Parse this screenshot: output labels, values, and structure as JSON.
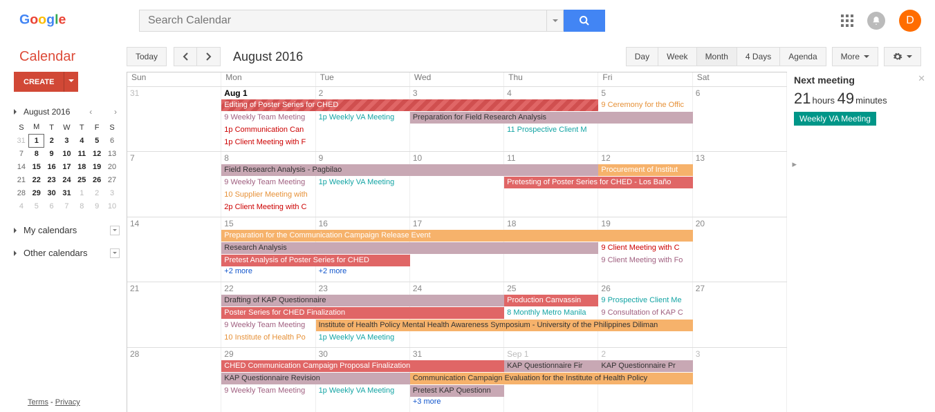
{
  "header": {
    "search_placeholder": "Search Calendar",
    "avatar_letter": "D"
  },
  "toolbar": {
    "brand": "Calendar",
    "today": "Today",
    "date_title": "August 2016",
    "views": [
      "Day",
      "Week",
      "Month",
      "4 Days",
      "Agenda"
    ],
    "active_view": 2,
    "more": "More"
  },
  "sidebar": {
    "create": "CREATE",
    "minical_title": "August 2016",
    "dow": [
      "S",
      "M",
      "T",
      "W",
      "T",
      "F",
      "S"
    ],
    "rows": [
      [
        {
          "n": 31,
          "g": 1
        },
        {
          "n": 1,
          "b": 1,
          "t": 1
        },
        {
          "n": 2,
          "b": 1
        },
        {
          "n": 3,
          "b": 1
        },
        {
          "n": 4,
          "b": 1
        },
        {
          "n": 5,
          "b": 1
        },
        {
          "n": 6
        }
      ],
      [
        {
          "n": 7
        },
        {
          "n": 8,
          "b": 1
        },
        {
          "n": 9,
          "b": 1
        },
        {
          "n": 10,
          "b": 1
        },
        {
          "n": 11,
          "b": 1
        },
        {
          "n": 12,
          "b": 1
        },
        {
          "n": 13
        }
      ],
      [
        {
          "n": 14
        },
        {
          "n": 15,
          "b": 1
        },
        {
          "n": 16,
          "b": 1
        },
        {
          "n": 17,
          "b": 1
        },
        {
          "n": 18,
          "b": 1
        },
        {
          "n": 19,
          "b": 1
        },
        {
          "n": 20
        }
      ],
      [
        {
          "n": 21
        },
        {
          "n": 22,
          "b": 1
        },
        {
          "n": 23,
          "b": 1
        },
        {
          "n": 24,
          "b": 1
        },
        {
          "n": 25,
          "b": 1
        },
        {
          "n": 26,
          "b": 1
        },
        {
          "n": 27
        }
      ],
      [
        {
          "n": 28
        },
        {
          "n": 29,
          "b": 1
        },
        {
          "n": 30,
          "b": 1
        },
        {
          "n": 31,
          "b": 1
        },
        {
          "n": 1,
          "g": 1
        },
        {
          "n": 2,
          "g": 1
        },
        {
          "n": 3,
          "g": 1
        }
      ],
      [
        {
          "n": 4,
          "g": 1
        },
        {
          "n": 5,
          "g": 1
        },
        {
          "n": 6,
          "g": 1
        },
        {
          "n": 7,
          "g": 1
        },
        {
          "n": 8,
          "g": 1
        },
        {
          "n": 9,
          "g": 1
        },
        {
          "n": 10,
          "g": 1
        }
      ]
    ],
    "my_calendars": "My calendars",
    "other_calendars": "Other calendars",
    "terms": "Terms",
    "privacy": "Privacy"
  },
  "calendar": {
    "day_headers": [
      "Sun",
      "Mon",
      "Tue",
      "Wed",
      "Thu",
      "Fri",
      "Sat"
    ],
    "weeks": [
      {
        "days": [
          {
            "num": "31",
            "other": 1
          },
          {
            "num": "Aug 1",
            "today": 1
          },
          {
            "num": "2"
          },
          {
            "num": "3"
          },
          {
            "num": "4"
          },
          {
            "num": "5"
          },
          {
            "num": "6"
          }
        ],
        "spans": [
          {
            "row": 0,
            "start": 1,
            "end": 5,
            "cls": "c-red-stripe",
            "text": "Editing of Poster Series for CHED"
          },
          {
            "row": 1,
            "start": 3,
            "end": 6,
            "cls": "c-mauve",
            "text": "Preparation for Field Research Analysis"
          }
        ],
        "cells": {
          "1": [
            {
              "cls": "t-mauve",
              "text": "9 Weekly Team Meeting",
              "row": 1
            },
            {
              "cls": "t-red",
              "text": "1p Communication Can",
              "row": 2
            },
            {
              "cls": "t-red",
              "text": "1p Client Meeting with F",
              "row": 3
            }
          ],
          "2": [
            {
              "cls": "t-teal",
              "text": "1p Weekly VA Meeting",
              "row": 1
            }
          ],
          "4": [
            {
              "cls": "t-teal",
              "text": "11 Prospective Client M",
              "row": 2
            }
          ],
          "5": [
            {
              "cls": "t-orange",
              "text": "9 Ceremony for the Offic",
              "row": 0
            }
          ]
        }
      },
      {
        "days": [
          {
            "num": "7"
          },
          {
            "num": "8"
          },
          {
            "num": "9"
          },
          {
            "num": "10"
          },
          {
            "num": "11"
          },
          {
            "num": "12"
          },
          {
            "num": "13"
          }
        ],
        "spans": [
          {
            "row": 0,
            "start": 1,
            "end": 5,
            "cls": "c-mauve",
            "text": "Field Research Analysis - Pagbilao"
          },
          {
            "row": 1,
            "start": 4,
            "end": 6,
            "cls": "c-red",
            "text": "Pretesting of Poster Series for CHED - Los Baño"
          }
        ],
        "cells": {
          "1": [
            {
              "cls": "t-mauve",
              "text": "9 Weekly Team Meeting",
              "row": 1
            },
            {
              "cls": "t-orange",
              "text": "10 Supplier Meeting with",
              "row": 2
            },
            {
              "cls": "t-red",
              "text": "2p Client Meeting with C",
              "row": 3
            }
          ],
          "2": [
            {
              "cls": "t-teal",
              "text": "1p Weekly VA Meeting",
              "row": 1
            }
          ],
          "5": [
            {
              "cls": "c-orange",
              "text": "Procurement of Institut",
              "row": 0,
              "block": 1
            }
          ]
        }
      },
      {
        "days": [
          {
            "num": "14"
          },
          {
            "num": "15"
          },
          {
            "num": "16"
          },
          {
            "num": "17"
          },
          {
            "num": "18"
          },
          {
            "num": "19"
          },
          {
            "num": "20"
          }
        ],
        "spans": [
          {
            "row": 0,
            "start": 1,
            "end": 6,
            "cls": "c-orange",
            "text": "Preparation for the Communication Campaign Release Event"
          },
          {
            "row": 1,
            "start": 1,
            "end": 5,
            "cls": "c-mauve",
            "text": "Research Analysis"
          },
          {
            "row": 2,
            "start": 1,
            "end": 3,
            "cls": "c-red",
            "text": "Pretest Analysis of Poster Series for CHED"
          }
        ],
        "cells": {
          "1": [
            {
              "cls": "more",
              "text": "+2 more",
              "row": 3,
              "more": 1
            }
          ],
          "2": [
            {
              "cls": "more",
              "text": "+2 more",
              "row": 3,
              "more": 1
            }
          ],
          "5": [
            {
              "cls": "t-red",
              "text": "9 Client Meeting with C",
              "row": 1
            },
            {
              "cls": "t-mauve",
              "text": "9 Client Meeting with Fo",
              "row": 2
            }
          ]
        }
      },
      {
        "days": [
          {
            "num": "21"
          },
          {
            "num": "22"
          },
          {
            "num": "23"
          },
          {
            "num": "24"
          },
          {
            "num": "25"
          },
          {
            "num": "26"
          },
          {
            "num": "27"
          }
        ],
        "spans": [
          {
            "row": 0,
            "start": 1,
            "end": 4,
            "cls": "c-mauve",
            "text": "Drafting of KAP Questionnaire"
          },
          {
            "row": 1,
            "start": 1,
            "end": 4,
            "cls": "c-red",
            "text": "Poster Series for CHED Finalization"
          },
          {
            "row": 2,
            "start": 2,
            "end": 6,
            "cls": "c-orange-light",
            "text": "Institute of Health Policy Mental Health Awareness Symposium - University of the Philippines Diliman"
          }
        ],
        "cells": {
          "1": [
            {
              "cls": "t-mauve",
              "text": "9 Weekly Team Meeting",
              "row": 2
            },
            {
              "cls": "t-orange",
              "text": "10 Institute of Health Po",
              "row": 3
            }
          ],
          "2": [
            {
              "cls": "t-teal",
              "text": "1p Weekly VA Meeting",
              "row": 3
            }
          ],
          "4": [
            {
              "cls": "c-red",
              "text": "Production Canvassin",
              "row": 0,
              "block": 1
            },
            {
              "cls": "t-teal",
              "text": "8 Monthly Metro Manila",
              "row": 1
            }
          ],
          "5": [
            {
              "cls": "t-teal",
              "text": "9 Prospective Client Me",
              "row": 0
            },
            {
              "cls": "t-mauve",
              "text": "9 Consultation of KAP C",
              "row": 1
            }
          ]
        }
      },
      {
        "days": [
          {
            "num": "28"
          },
          {
            "num": "29"
          },
          {
            "num": "30"
          },
          {
            "num": "31"
          },
          {
            "num": "Sep 1",
            "other": 1
          },
          {
            "num": "2",
            "other": 1
          },
          {
            "num": "3",
            "other": 1
          }
        ],
        "spans": [
          {
            "row": 0,
            "start": 1,
            "end": 4,
            "cls": "c-red",
            "text": "CHED Communication Campaign Proposal Finalization"
          },
          {
            "row": 1,
            "start": 1,
            "end": 3,
            "cls": "c-mauve",
            "text": "KAP Questionnaire Revision"
          },
          {
            "row": 1,
            "start": 3,
            "end": 6,
            "cls": "c-orange-light",
            "text": "Communication Campaign Evaluation for the Institute of Health Policy"
          }
        ],
        "cells": {
          "1": [
            {
              "cls": "t-mauve",
              "text": "9 Weekly Team Meeting",
              "row": 2
            }
          ],
          "2": [
            {
              "cls": "t-teal",
              "text": "1p Weekly VA Meeting",
              "row": 2
            }
          ],
          "3": [
            {
              "cls": "c-mauve",
              "text": "Pretest KAP Questionn",
              "row": 2,
              "block": 1
            },
            {
              "cls": "more",
              "text": "+3 more",
              "row": 3,
              "more": 1
            }
          ],
          "4": [
            {
              "cls": "c-mauve",
              "text": "KAP Questionnaire Fir",
              "row": 0,
              "block": 1
            }
          ],
          "5": [
            {
              "cls": "c-mauve",
              "text": "KAP Questionnaire Pr",
              "row": 0,
              "block": 1
            }
          ]
        }
      }
    ]
  },
  "rightpanel": {
    "title": "Next meeting",
    "hours": "21",
    "hours_label": "hours",
    "mins": "49",
    "mins_label": "minutes",
    "event": "Weekly VA Meeting"
  }
}
